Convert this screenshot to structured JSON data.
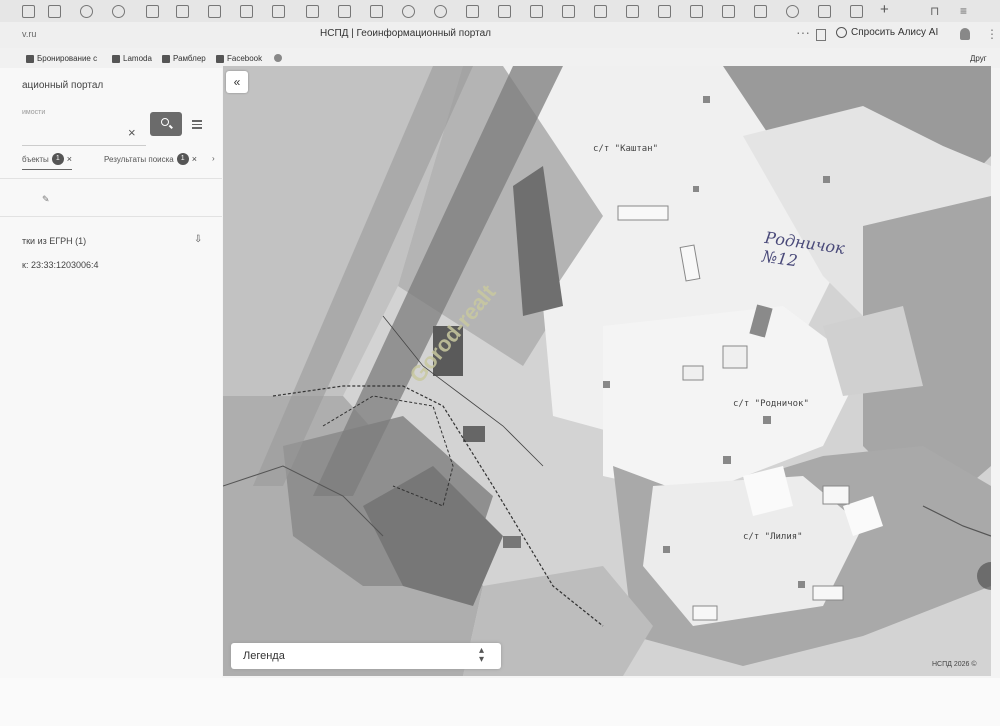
{
  "browser": {
    "url_fragment": "v.ru",
    "page_title": "НСПД | Геоинформационный портал",
    "ask_alice": "Спросить Алису AI",
    "bookmarks": [
      {
        "label": "Бронирование с"
      },
      {
        "label": "Lamoda"
      },
      {
        "label": "Рамблер"
      },
      {
        "label": "Facebook"
      }
    ],
    "other_bookmarks": "Друг"
  },
  "sidebar": {
    "portal_title": "ационный портал",
    "search_label": "имости",
    "search_value": "",
    "tab_objects": {
      "label": "бъекты",
      "count": "1"
    },
    "tab_results": {
      "label": "Результаты поиска",
      "count": "1"
    },
    "egrn_title": "тки из ЕГРН (1)",
    "kn_item": "к: 23:33:1203006:4"
  },
  "map": {
    "collapse_glyph": "«",
    "legend_label": "Легенда",
    "copyright": "НСПД 2026 ©",
    "watermark": "Gorod-realt",
    "labels": {
      "kavtan": "с/т \"Каштан\"",
      "rodnichok": "с/т \"Родничок\"",
      "liliya": "с/т \"Лилия\""
    },
    "handwritten": "Родничок №12"
  }
}
